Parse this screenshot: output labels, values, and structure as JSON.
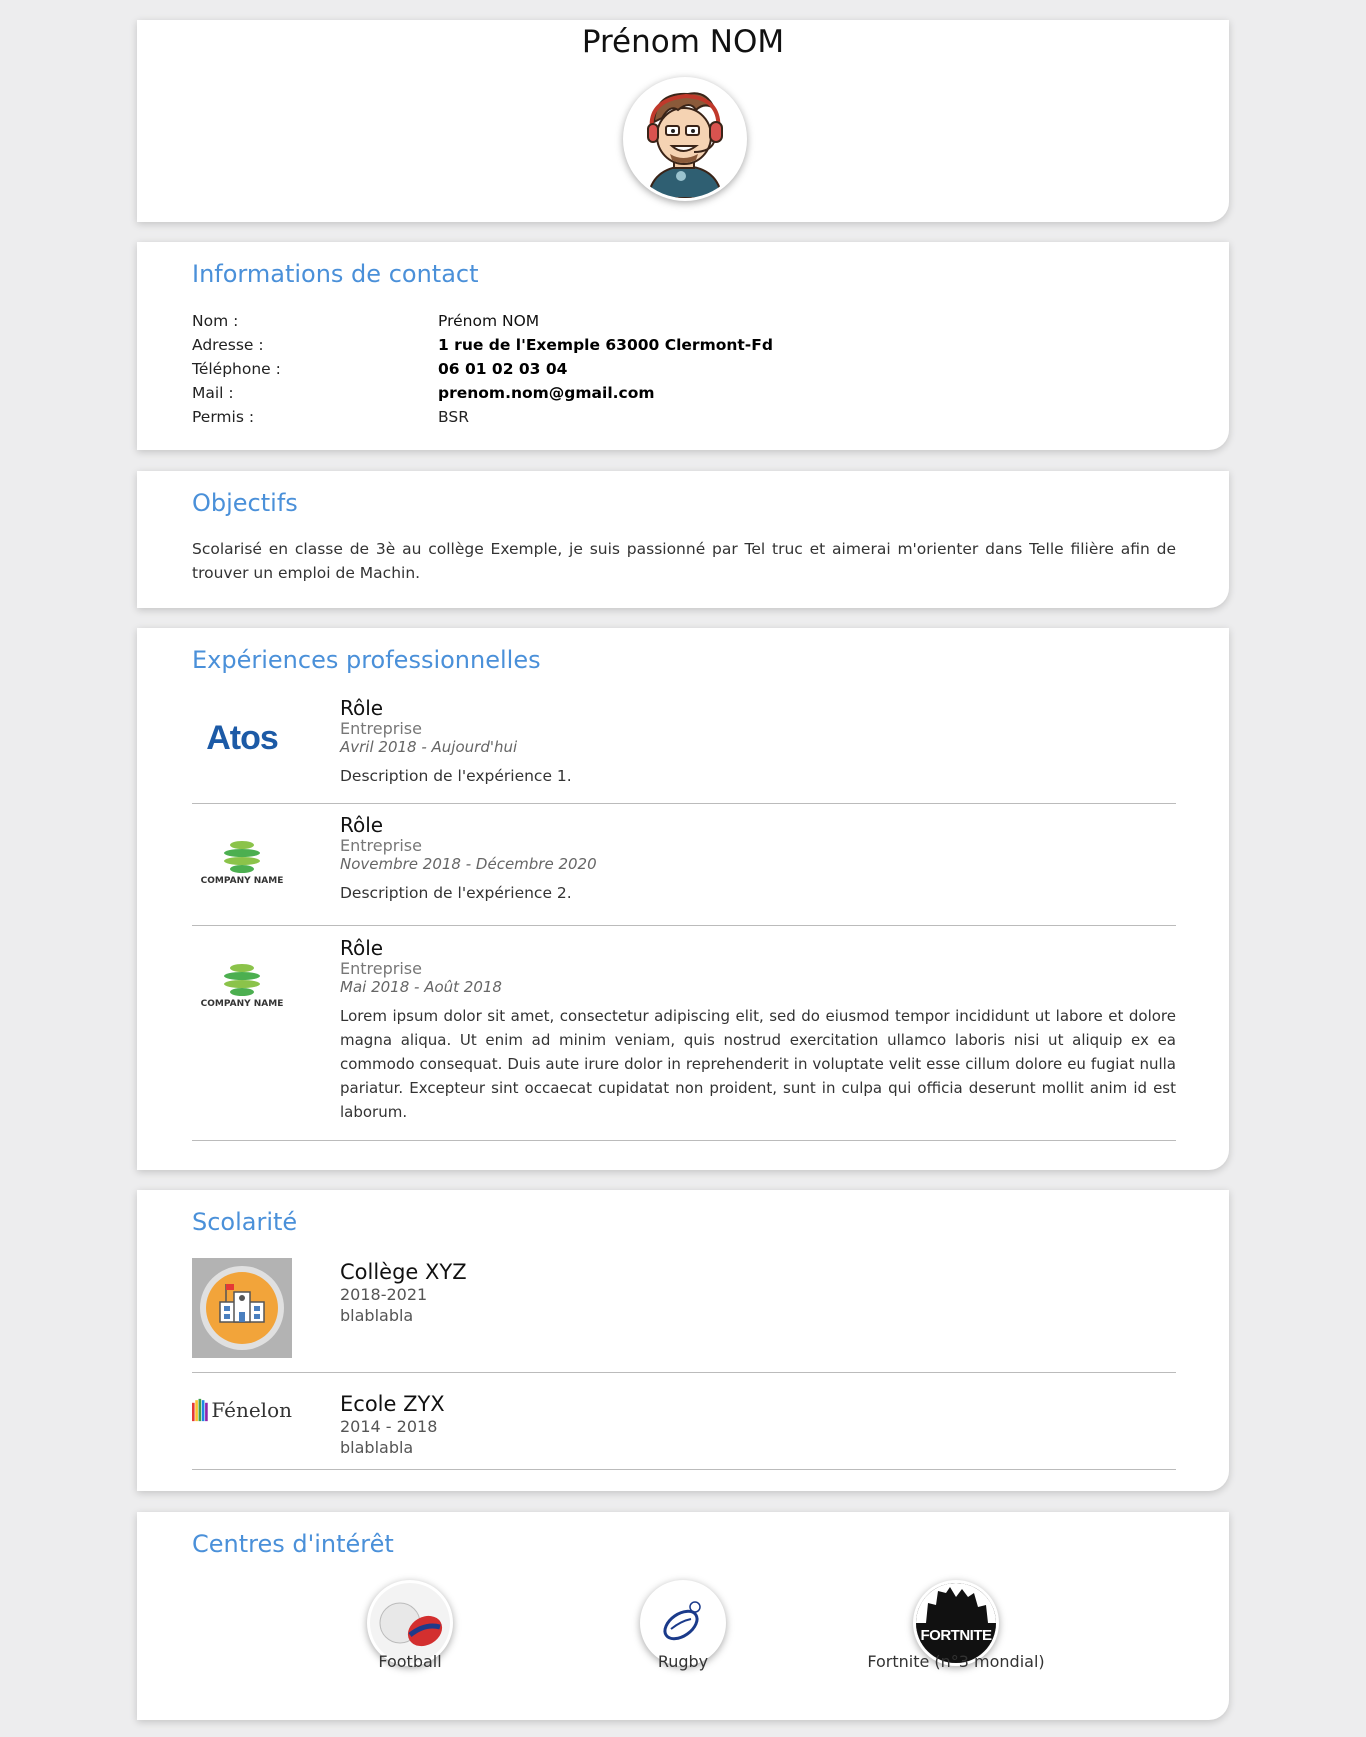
{
  "header": {
    "name": "Prénom NOM",
    "avatar_icon": "cartoon-gamer-avatar-icon"
  },
  "contact": {
    "title": "Informations de contact",
    "rows": [
      {
        "label": "Nom :",
        "value": "Prénom NOM"
      },
      {
        "label": "Adresse :",
        "value": "1 rue de l'Exemple 63000 Clermont-Fd"
      },
      {
        "label": "Téléphone :",
        "value": "06 01 02 03 04"
      },
      {
        "label": "Mail :",
        "value": "prenom.nom@gmail.com"
      },
      {
        "label": "Permis :",
        "value": "BSR"
      }
    ]
  },
  "objectives": {
    "title": "Objectifs",
    "text": "Scolarisé en classe de 3è au collège Exemple, je suis passionné par Tel truc et aimerai m'orienter dans Telle filière afin de trouver un emploi de Machin."
  },
  "experiences": {
    "title": "Expériences professionnelles",
    "items": [
      {
        "logo": "Atos",
        "role": "Rôle",
        "company": "Entreprise",
        "dates": "Avril 2018 - Aujourd'hui",
        "description": "Description de l'expérience 1."
      },
      {
        "logo": "COMPANY NAME",
        "role": "Rôle",
        "company": "Entreprise",
        "dates": "Novembre 2018 - Décembre 2020",
        "description": "Description de l'expérience 2."
      },
      {
        "logo": "COMPANY NAME",
        "role": "Rôle",
        "company": "Entreprise",
        "dates": "Mai 2018 - Août 2018",
        "description": "Lorem ipsum dolor sit amet, consectetur adipiscing elit, sed do eiusmod tempor incididunt ut labore et dolore magna aliqua. Ut enim ad minim veniam, quis nostrud exercitation ullamco laboris nisi ut aliquip ex ea commodo consequat. Duis aute irure dolor in reprehenderit in voluptate velit esse cillum dolore eu fugiat nulla pariatur. Excepteur sint occaecat cupidatat non proident, sunt in culpa qui officia deserunt mollit anim id est laborum."
      }
    ]
  },
  "schooling": {
    "title": "Scolarité",
    "items": [
      {
        "logo": "school-building-icon",
        "name": "Collège XYZ",
        "years": "2018-2021",
        "description": "blablabla"
      },
      {
        "logo": "Fénelon",
        "name": "Ecole ZYX",
        "years": "2014 - 2018",
        "description": "blablabla"
      }
    ]
  },
  "interests": {
    "title": "Centres d'intérêt",
    "items": [
      {
        "icon": "football-icon",
        "label": "Football"
      },
      {
        "icon": "rugby-ball-icon",
        "label": "Rugby"
      },
      {
        "icon": "fortnite-logo-icon",
        "label": "Fortnite (n°3 mondial)"
      }
    ]
  },
  "colors": {
    "accent": "#4a90d9",
    "background": "#ededee",
    "card": "#ffffff"
  }
}
